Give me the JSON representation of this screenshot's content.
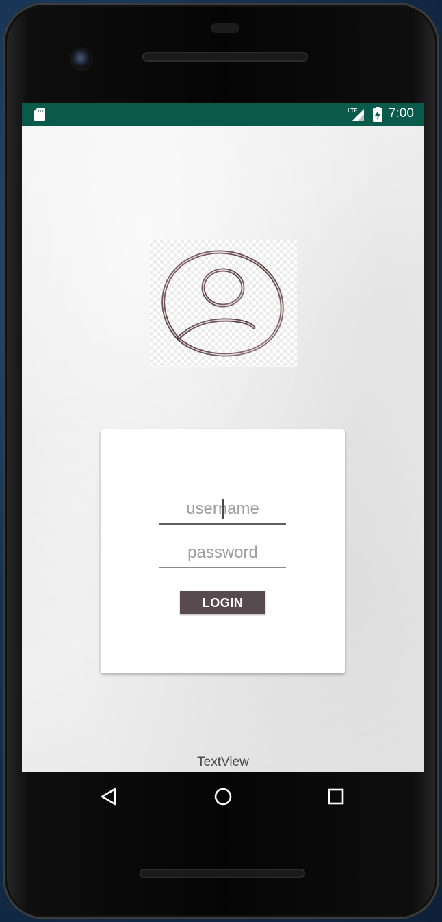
{
  "status_bar": {
    "time": "7:00",
    "network": "LTE",
    "background_color": "#0a5a4c"
  },
  "icons": {
    "sd_card": "sd-card-icon",
    "signal": "lte-signal-icon",
    "battery": "battery-charging-icon",
    "avatar": "user-avatar-icon",
    "back": "back-triangle-icon",
    "home": "home-circle-icon",
    "recents": "recents-square-icon"
  },
  "login_form": {
    "username_placeholder": "username",
    "password_placeholder": "password",
    "login_label": "LOGIN",
    "button_color": "#574b4f"
  },
  "footer": {
    "textview": "TextView"
  }
}
